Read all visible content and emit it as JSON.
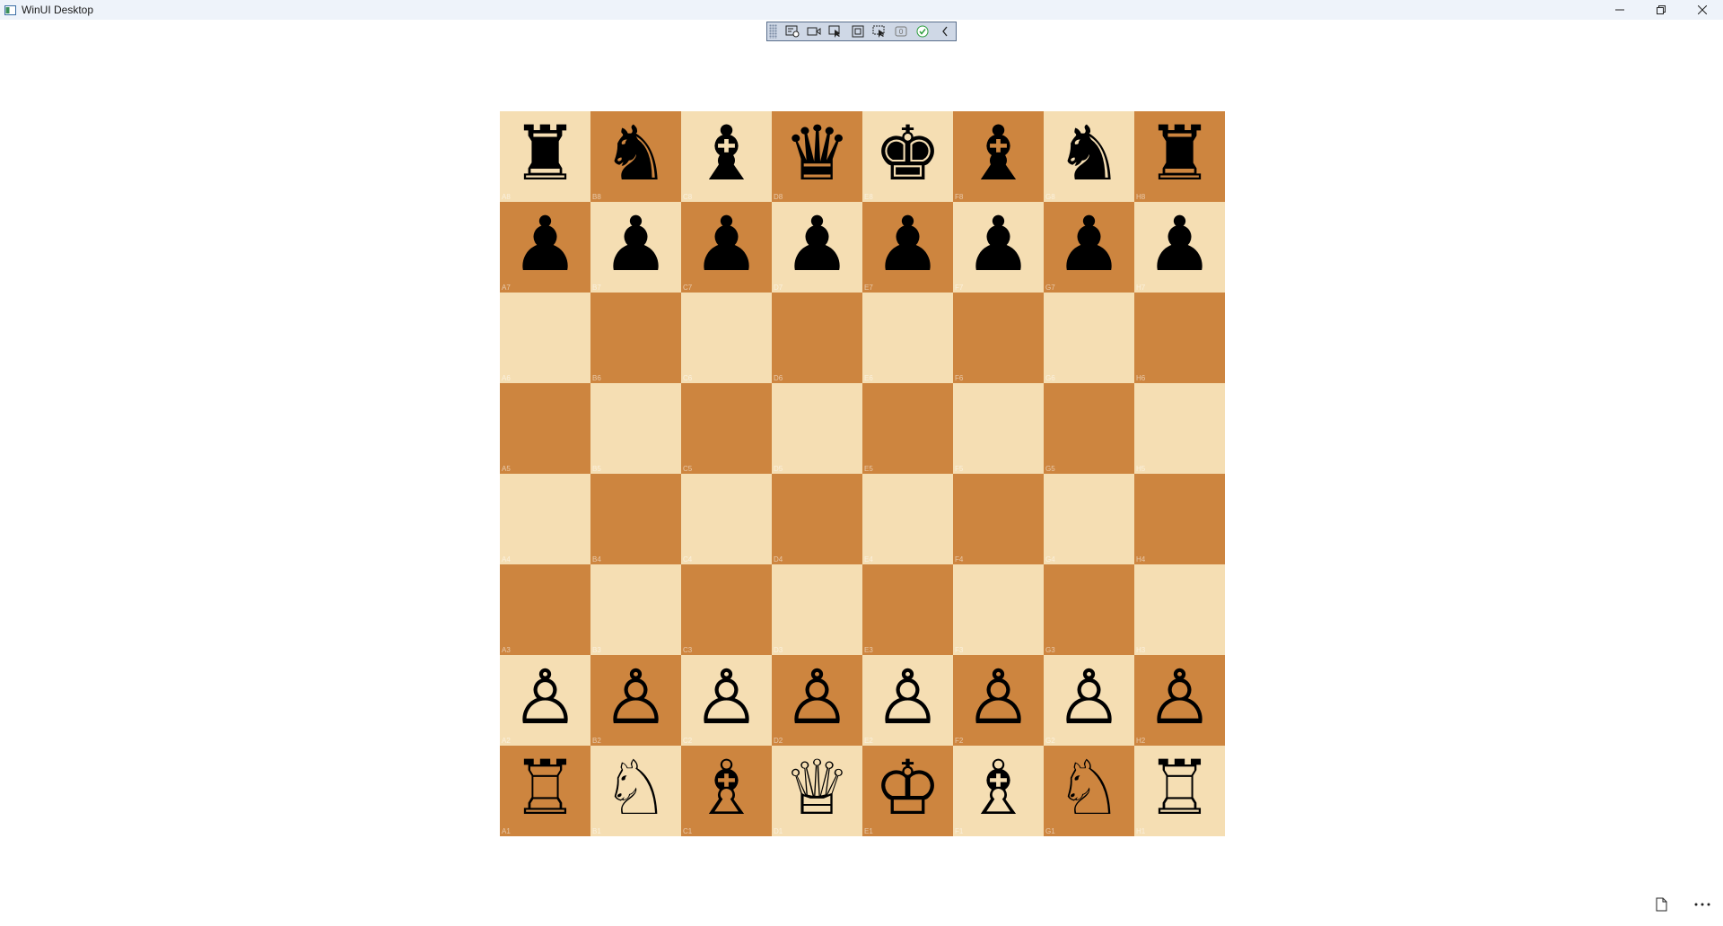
{
  "window": {
    "title": "WinUI Desktop",
    "controls": [
      "minimize-icon",
      "restore-icon",
      "close-icon"
    ]
  },
  "dev_toolbar": {
    "buttons": [
      {
        "name": "app-display-icon"
      },
      {
        "name": "record-icon"
      },
      {
        "name": "select-element-icon"
      },
      {
        "name": "display-layout-icon"
      },
      {
        "name": "track-focus-icon"
      },
      {
        "name": "binding-failures-icon"
      },
      {
        "name": "accessibility-check-icon"
      },
      {
        "name": "collapse-chevron-icon"
      }
    ],
    "accent": "#5a6f8c"
  },
  "board": {
    "light_color": "#f5deb3",
    "dark_color": "#cd853f",
    "files": [
      "A",
      "B",
      "C",
      "D",
      "E",
      "F",
      "G",
      "H"
    ],
    "ranks": [
      "8",
      "7",
      "6",
      "5",
      "4",
      "3",
      "2",
      "1"
    ],
    "rows": [
      [
        "♜",
        "♞",
        "♝",
        "♛",
        "♚",
        "♝",
        "♞",
        "♜"
      ],
      [
        "♟",
        "♟",
        "♟",
        "♟",
        "♟",
        "♟",
        "♟",
        "♟"
      ],
      [
        "",
        "",
        "",
        "",
        "",
        "",
        "",
        ""
      ],
      [
        "",
        "",
        "",
        "",
        "",
        "",
        "",
        ""
      ],
      [
        "",
        "",
        "",
        "",
        "",
        "",
        "",
        ""
      ],
      [
        "",
        "",
        "",
        "",
        "",
        "",
        "",
        ""
      ],
      [
        "♙",
        "♙",
        "♙",
        "♙",
        "♙",
        "♙",
        "♙",
        "♙"
      ],
      [
        "♖",
        "♘",
        "♗",
        "♕",
        "♔",
        "♗",
        "♘",
        "♖"
      ]
    ],
    "coords": [
      [
        "A8",
        "B8",
        "C8",
        "D8",
        "E8",
        "F8",
        "G8",
        "H8"
      ],
      [
        "A7",
        "B7",
        "C7",
        "D7",
        "E7",
        "F7",
        "G7",
        "H7"
      ],
      [
        "A6",
        "B6",
        "C6",
        "D6",
        "E6",
        "F6",
        "G6",
        "H6"
      ],
      [
        "A5",
        "B5",
        "C5",
        "D5",
        "E5",
        "F5",
        "G5",
        "H5"
      ],
      [
        "A4",
        "B4",
        "C4",
        "D4",
        "E4",
        "F4",
        "G4",
        "H4"
      ],
      [
        "A3",
        "B3",
        "C3",
        "D3",
        "E3",
        "F3",
        "G3",
        "H3"
      ],
      [
        "A2",
        "B2",
        "C2",
        "D2",
        "E2",
        "F2",
        "G2",
        "H2"
      ],
      [
        "A1",
        "B1",
        "C1",
        "D1",
        "E1",
        "F1",
        "G1",
        "H1"
      ]
    ]
  },
  "footer": {
    "buttons": [
      "page-icon",
      "more-options-icon"
    ]
  }
}
